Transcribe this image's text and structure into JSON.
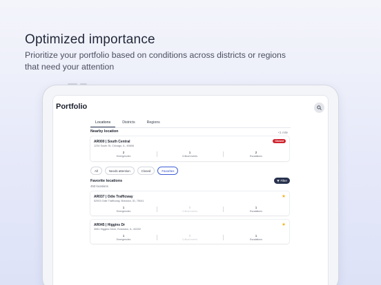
{
  "hero": {
    "headline": "Optimized importance",
    "subline": "Prioritize your portfolio based on conditions across districts or regions that need your attention"
  },
  "app": {
    "title": "Portfolio",
    "search_icon": "search-icon",
    "tabs": [
      {
        "label": "Locations",
        "active": true
      },
      {
        "label": "Districts",
        "active": false
      },
      {
        "label": "Regions",
        "active": false
      }
    ]
  },
  "nearby": {
    "title": "Nearby location",
    "distance": "<1 mile",
    "card": {
      "title": "AR000 | South Central",
      "address": "1234 South St, Chicago, IL, 60606",
      "badge": "Closed",
      "stats": [
        {
          "value": "2",
          "label": "Emergencies"
        },
        {
          "value": "1",
          "label": "Critical events"
        },
        {
          "value": "2",
          "label": "Escalations"
        }
      ]
    }
  },
  "filters": {
    "chips": [
      {
        "label": "All",
        "active": false
      },
      {
        "label": "Needs attention",
        "active": false
      },
      {
        "label": "Closed",
        "active": false
      },
      {
        "label": "Favorites",
        "active": true
      }
    ],
    "filter_button": "Filter",
    "filter_icon": "funnel-icon"
  },
  "favorites": {
    "title": "Favorite locations",
    "count": "453 locations",
    "items": [
      {
        "title": "AR037 | Odie Trafficway",
        "address": "52903 Odie Trafficway, Brandon, ID, 75041",
        "stats": [
          {
            "value": "1",
            "label": "Emergencies"
          },
          {
            "value": "0",
            "label": "Critical events"
          },
          {
            "value": "1",
            "label": "Escalations"
          }
        ]
      },
      {
        "title": "AR045 | Higgins Dr",
        "address": "3081 Higgins Drive, Evanston, IL, 82202",
        "stats": [
          {
            "value": "1",
            "label": "Emergencies"
          },
          {
            "value": "0",
            "label": "Critical events"
          },
          {
            "value": "1",
            "label": "Escalations"
          }
        ]
      }
    ]
  },
  "colors": {
    "accent": "#3c5bd8",
    "closed": "#d0222e",
    "star": "#f2b21a",
    "filter_bg": "#27314d"
  }
}
